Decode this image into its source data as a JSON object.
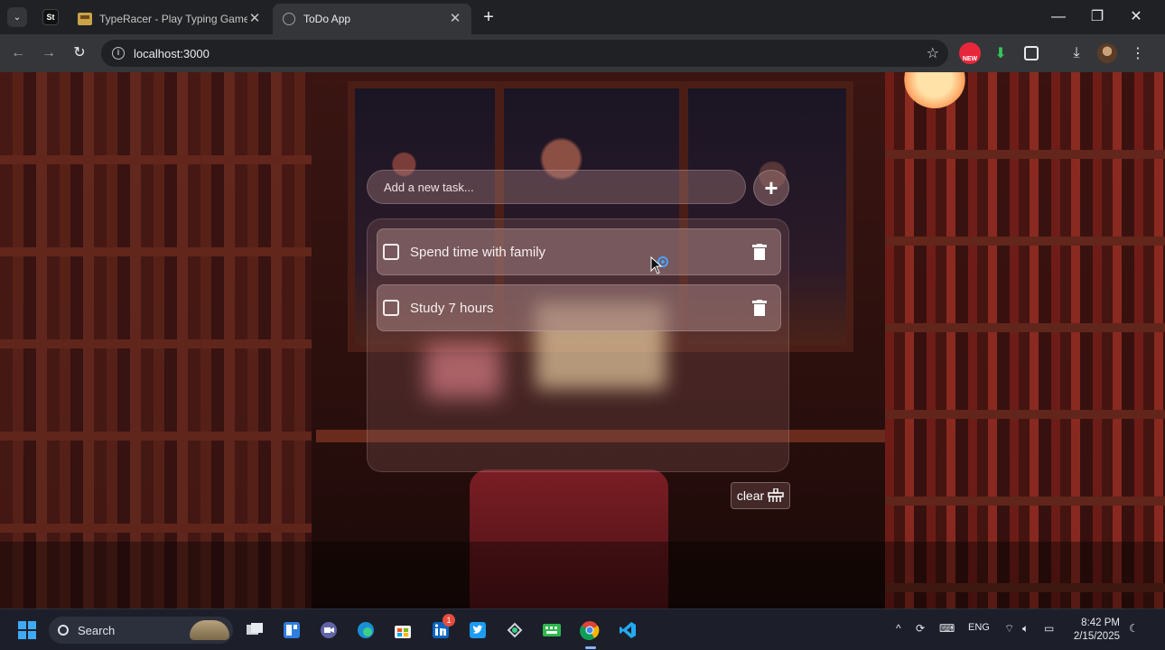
{
  "browser": {
    "pinned_tab_label": "St",
    "tabs": [
      {
        "title": "TypeRacer - Play Typing Games",
        "active": false
      },
      {
        "title": "ToDo App",
        "active": true
      }
    ],
    "url": "localhost:3000",
    "extension_badge": "NEW"
  },
  "app": {
    "input_placeholder": "Add a new task...",
    "todos": [
      {
        "text": "Spend time with family",
        "done": false
      },
      {
        "text": "Study 7 hours",
        "done": false
      }
    ],
    "clear_label": "clear"
  },
  "taskbar": {
    "search_label": "Search",
    "linkedin_badge": "1",
    "language": "ENG",
    "time": "8:42 PM",
    "date": "2/15/2025"
  },
  "colors": {
    "accent": "#8ab4f8",
    "chrome_tab_bg": "#35363a"
  }
}
